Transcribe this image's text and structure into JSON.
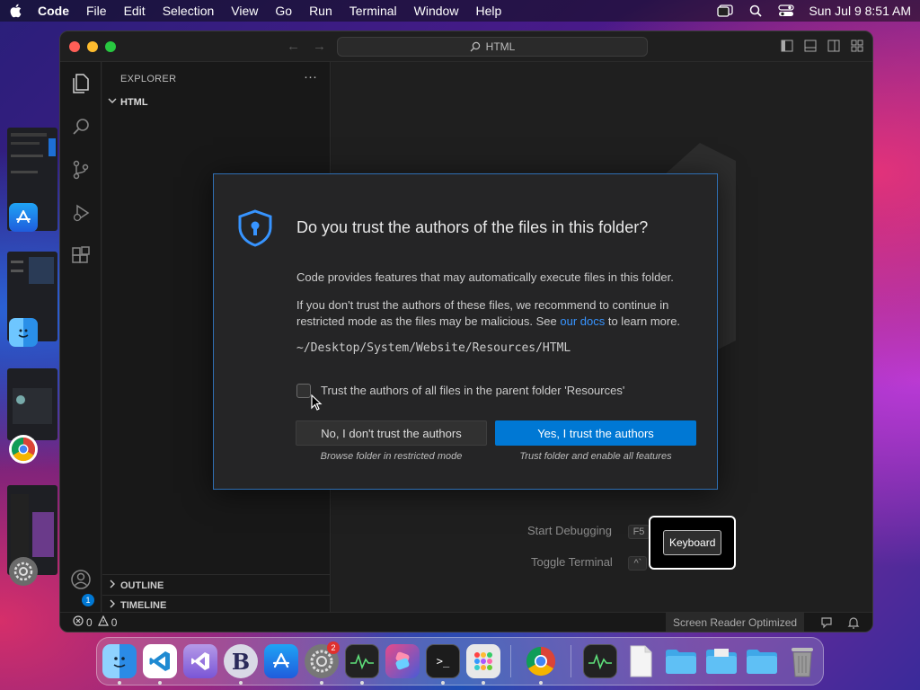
{
  "menubar": {
    "app_name": "Code",
    "items": [
      "File",
      "Edit",
      "Selection",
      "View",
      "Go",
      "Run",
      "Terminal",
      "Window",
      "Help"
    ],
    "datetime": "Sun Jul 9  8:51 AM"
  },
  "window": {
    "command_center": "HTML",
    "sidebar": {
      "header": "EXPLORER",
      "more": "···",
      "folder": "HTML",
      "outline": "OUTLINE",
      "timeline": "TIMELINE"
    },
    "accounts_badge": "1",
    "editor_shortcuts": [
      {
        "label": "Start Debugging",
        "key": "F5"
      },
      {
        "label": "Toggle Terminal",
        "key": "^`"
      }
    ],
    "status": {
      "errors": "0",
      "warnings": "0",
      "screen_reader": "Screen Reader Optimized"
    }
  },
  "dialog": {
    "title": "Do you trust the authors of the files in this folder?",
    "paragraph1": "Code provides features that may automatically execute files in this folder.",
    "paragraph2_pre": "If you don't trust the authors of these files, we recommend to continue in restricted mode as the files may be malicious. See ",
    "paragraph2_link": "our docs",
    "paragraph2_post": " to learn more.",
    "path": "~/Desktop/System/Website/Resources/HTML",
    "checkbox_label": "Trust the authors of all files in the parent folder 'Resources'",
    "checkbox_checked": false,
    "no_button": "No, I don't trust the authors",
    "no_sub": "Browse folder in restricted mode",
    "yes_button": "Yes, I trust the authors",
    "yes_sub": "Trust folder and enable all features"
  },
  "tooltip": {
    "label": "Keyboard"
  },
  "dock": {
    "settings_badge": "2",
    "apps": [
      "finder-icon",
      "vscode-icon",
      "visual-studio-icon",
      "bbedit-icon",
      "app-store-icon",
      "system-settings-icon",
      "activity-monitor-icon",
      "shortcuts-icon",
      "terminal-icon",
      "launchpad-icon",
      "chrome-icon",
      "activity-monitor-icon",
      "document-icon",
      "folder-icon",
      "folder-icon",
      "folder-icon",
      "trash-icon"
    ]
  },
  "colors": {
    "accent": "#0078d4",
    "link": "#3794ff",
    "dialog_border": "#2f6fb3"
  }
}
